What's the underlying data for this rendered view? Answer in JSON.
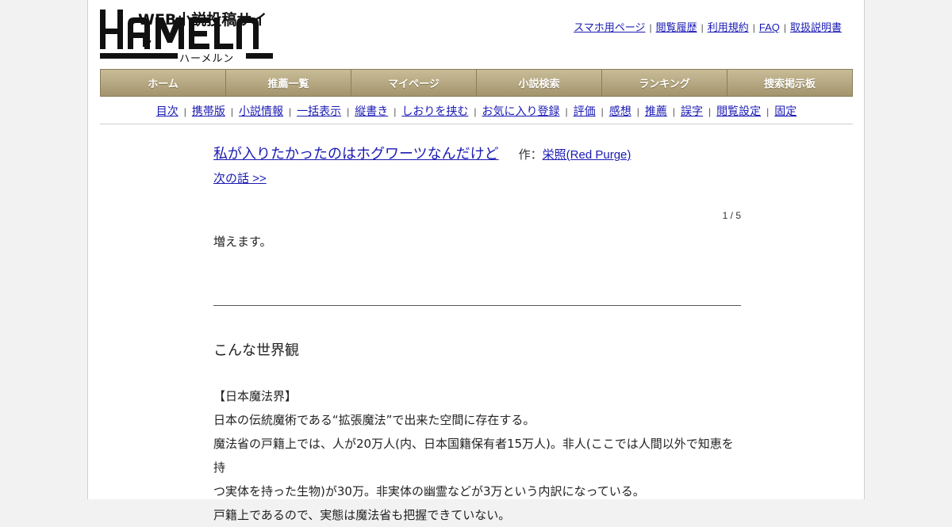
{
  "logo": {
    "tagline": "WEB小説投稿サイト",
    "wordmark": "HAMELN",
    "kana": "ハーメルン"
  },
  "top_links": [
    "スマホ用ページ",
    "閲覧履歴",
    "利用規約",
    "FAQ",
    "取扱説明書"
  ],
  "nav": [
    "ホーム",
    "推薦一覧",
    "マイページ",
    "小説検索",
    "ランキング",
    "捜索掲示板"
  ],
  "subnav": [
    "目次",
    "携帯版",
    "小説情報",
    "一括表示",
    "縦書き",
    "しおりを挟む",
    "お気に入り登録",
    "評価",
    "感想",
    "推薦",
    "誤字",
    "閲覧設定",
    "固定"
  ],
  "novel": {
    "title": "私が入りたかったのはホグワーツなんだけど",
    "author_prefix": "作：",
    "author": "栄照(Red Purge)",
    "next_link": "次の話 >>",
    "pager": "1 / 5",
    "preface": "増えます。",
    "chapter_title": "こんな世界観",
    "paragraphs": [
      "【日本魔法界】",
      "日本の伝統魔術である“拡張魔法”で出来た空間に存在する。",
      "魔法省の戸籍上では、人が20万人(内、日本国籍保有者15万人)。非人(ここでは人間以外で知恵を持",
      "つ実体を持った生物)が30万。非実体の幽霊などが3万という内訳になっている。",
      "戸籍上であるので、実態は魔法省も把握できていない。"
    ]
  },
  "colors": {
    "link": "#1a1ab3",
    "nav_gold_top": "#c9bd98",
    "nav_gold_bottom": "#a2946d"
  }
}
